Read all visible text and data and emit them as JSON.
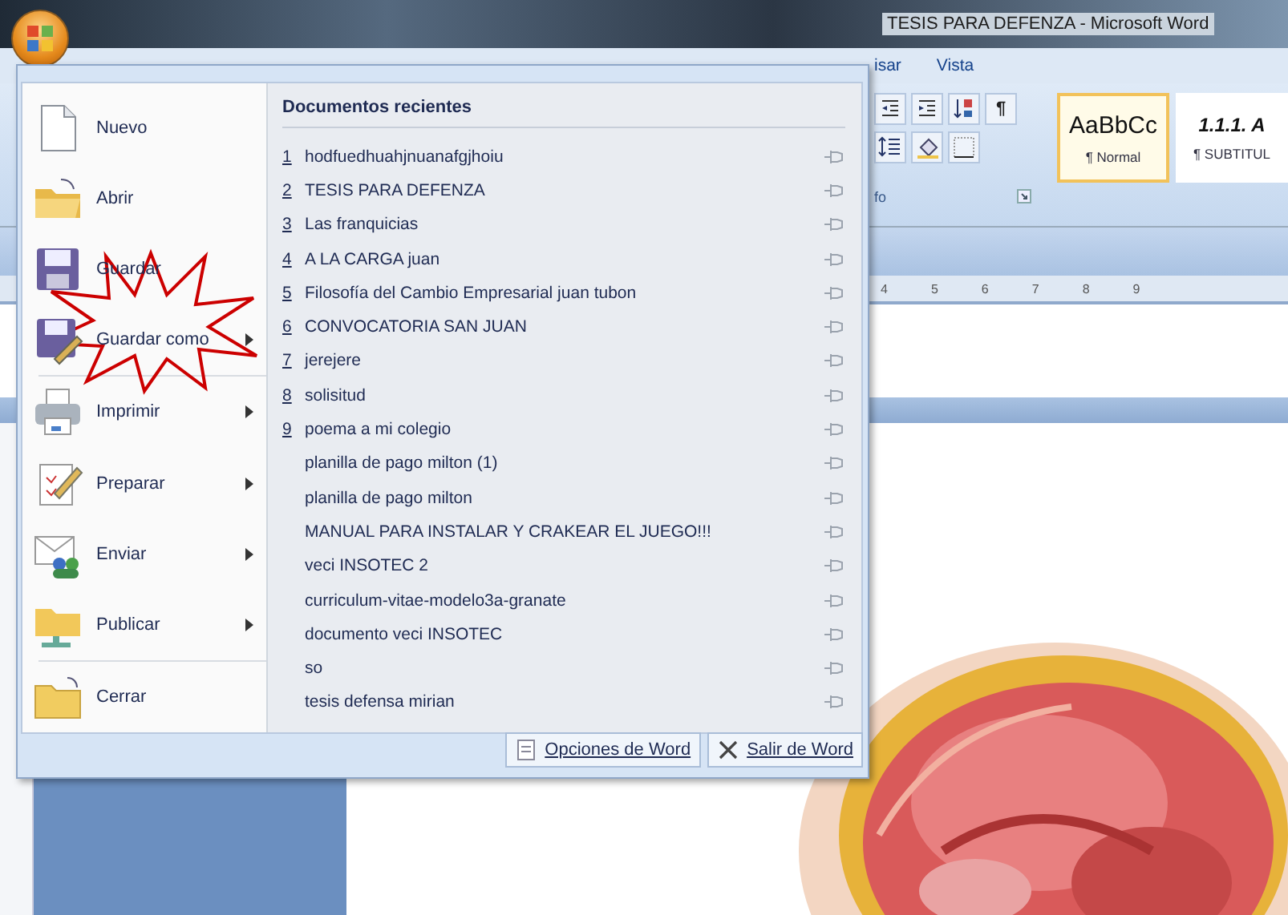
{
  "window": {
    "title": "TESIS PARA DEFENZA - Microsoft Word"
  },
  "ribbon": {
    "tabs": [
      {
        "label": "isar"
      },
      {
        "label": "Vista"
      }
    ],
    "paragraph_buttons": [
      {
        "kind": "decrease-indent"
      },
      {
        "kind": "increase-indent"
      },
      {
        "kind": "sort"
      },
      {
        "kind": "pilcrow",
        "label": "¶"
      },
      {
        "kind": "line-spacing"
      },
      {
        "kind": "shading"
      },
      {
        "kind": "borders"
      }
    ],
    "group_label": "fo",
    "styles": [
      {
        "preview": "AaBbCc",
        "name": "¶ Normal",
        "selected": true
      },
      {
        "preview": "1.1.1. A",
        "name": "¶ SUBTITUL",
        "selected": false
      }
    ]
  },
  "ruler": {
    "numbers": [
      "4",
      "5",
      "6",
      "7",
      "8",
      "9"
    ]
  },
  "office_menu": {
    "commands": [
      {
        "label": "Nuevo",
        "kind": "new",
        "submenu": false,
        "separator_before": false
      },
      {
        "label": "Abrir",
        "kind": "open",
        "submenu": false,
        "separator_before": false
      },
      {
        "label": "Guardar",
        "kind": "save",
        "submenu": false,
        "separator_before": false
      },
      {
        "label": "Guardar como",
        "kind": "save-as",
        "submenu": true,
        "separator_before": false
      },
      {
        "label": "Imprimir",
        "kind": "print",
        "submenu": true,
        "separator_before": true
      },
      {
        "label": "Preparar",
        "kind": "prepare",
        "submenu": true,
        "separator_before": false
      },
      {
        "label": "Enviar",
        "kind": "send",
        "submenu": true,
        "separator_before": false
      },
      {
        "label": "Publicar",
        "kind": "publish",
        "submenu": true,
        "separator_before": false
      },
      {
        "label": "Cerrar",
        "kind": "close",
        "submenu": false,
        "separator_before": true
      }
    ],
    "recent": {
      "heading": "Documentos recientes",
      "items": [
        {
          "number": "1",
          "name": "hodfuedhuahjnuanafgjhoiu"
        },
        {
          "number": "2",
          "name": "TESIS PARA DEFENZA"
        },
        {
          "number": "3",
          "name": "Las franquicias"
        },
        {
          "number": "4",
          "name": "A LA CARGA juan"
        },
        {
          "number": "5",
          "name": "Filosofía del Cambio Empresarial juan tubon"
        },
        {
          "number": "6",
          "name": "CONVOCATORIA SAN JUAN"
        },
        {
          "number": "7",
          "name": "jerejere"
        },
        {
          "number": "8",
          "name": "solisitud"
        },
        {
          "number": "9",
          "name": "poema a mi colegio"
        },
        {
          "name": "planilla de pago milton (1)"
        },
        {
          "name": "planilla de pago milton"
        },
        {
          "name": "MANUAL PARA INSTALAR Y CRAKEAR EL JUEGO!!!"
        },
        {
          "name": "veci INSOTEC 2"
        },
        {
          "name": "curriculum-vitae-modelo3a-granate"
        },
        {
          "name": "documento veci INSOTEC"
        },
        {
          "name": "so"
        },
        {
          "name": "tesis defensa mirian"
        }
      ]
    },
    "footer_buttons": [
      {
        "label": "Opciones de Word",
        "kind": "options"
      },
      {
        "label": "Salir de Word",
        "kind": "exit"
      }
    ]
  }
}
